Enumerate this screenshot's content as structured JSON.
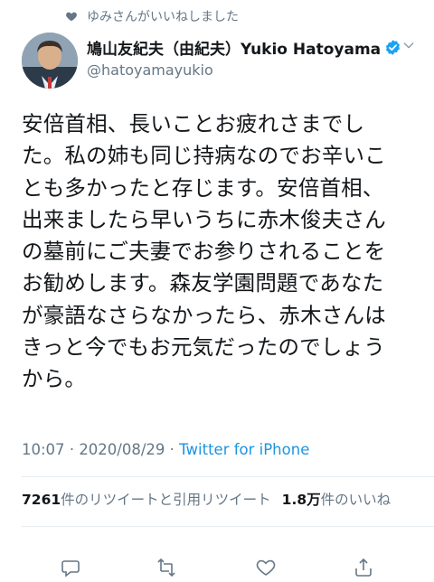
{
  "social_context": {
    "icon": "heart-icon",
    "text": "ゆみさんがいいねしました"
  },
  "author": {
    "display_name": "鳩山友紀夫（由紀夫）Yukio Hatoyama",
    "handle": "@hatoyamayukio",
    "verified": true,
    "avatar_icon": "avatar"
  },
  "tweet": {
    "text": "安倍首相、長いことお疲れさまでした。私の姉も同じ持病なのでお辛いことも多かったと存じます。安倍首相、出来ましたら早いうちに赤木俊夫さんの墓前にご夫妻でお参りされることをお勧めします。森友学園問題であなたが豪語なさらなかったら、赤木さんはきっと今でもお元気だったのでしょうから。",
    "lines": [
      "安倍首相、長いことお疲れさまでし",
      "た。私の姉も同じ持病なのでお辛いこ",
      "とも多かったと存じます。安倍首相、",
      "出来ましたら早いうちに赤木俊夫さん",
      "の墓前にご夫妻でお参りされることを",
      "お勧めします。森友学園問題であなた",
      "が豪語なさらなかったら、赤木さんは",
      "きっと今でもお元気だったのでしょう",
      "から。"
    ],
    "time": "10:07",
    "separator": "·",
    "date": "2020/08/29",
    "source": "Twitter for iPhone"
  },
  "stats": {
    "retweets_count": "7261",
    "retweets_label": "件のリツイートと引用リツイート",
    "likes_count": "1.8万",
    "likes_label": "件のいいね"
  },
  "actions": [
    "reply-icon",
    "retweet-icon",
    "like-icon",
    "share-icon"
  ],
  "colors": {
    "text": "#14171a",
    "secondary": "#657786",
    "link": "#1b95e0",
    "verified": "#1da1f2",
    "divider": "#e6ecf0"
  }
}
